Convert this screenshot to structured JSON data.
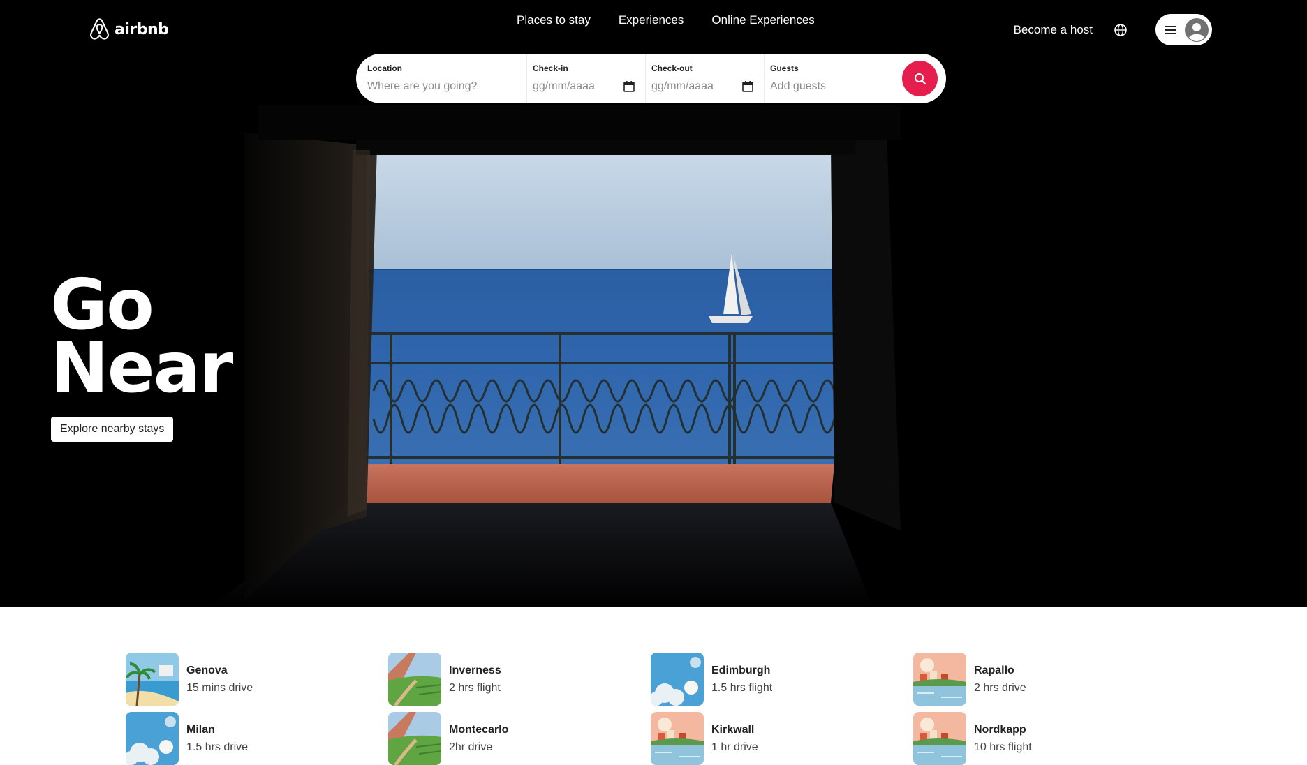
{
  "brand": {
    "logo_text": "airbnb",
    "accent_color": "#e61e4d"
  },
  "nav": {
    "items": [
      {
        "label": "Places to stay"
      },
      {
        "label": "Experiences"
      },
      {
        "label": "Online Experiences"
      }
    ],
    "become_host": "Become a host",
    "globe_icon": "globe-icon",
    "menu_icon": "hamburger-icon",
    "avatar_icon": "user-avatar-icon"
  },
  "search": {
    "location_label": "Location",
    "location_placeholder": "Where are you going?",
    "checkin_label": "Check-in",
    "checkin_placeholder": "gg/mm/aaaa",
    "checkout_label": "Check-out",
    "checkout_placeholder": "gg/mm/aaaa",
    "guests_label": "Guests",
    "guests_placeholder": "Add guests",
    "search_icon": "search-icon"
  },
  "hero": {
    "title_line1": "Go",
    "title_line2": "Near",
    "cta": "Explore nearby stays"
  },
  "nearby": [
    {
      "city": "Genova",
      "distance": "15 mins drive",
      "thumb": "beach-palms"
    },
    {
      "city": "Inverness",
      "distance": "2 hrs flight",
      "thumb": "green-valley"
    },
    {
      "city": "Edimburgh",
      "distance": "1.5 hrs flight",
      "thumb": "blue-sky-clouds"
    },
    {
      "city": "Rapallo",
      "distance": "2 hrs drive",
      "thumb": "lake-village"
    },
    {
      "city": "Milan",
      "distance": "1.5 hrs drive",
      "thumb": "blue-sky-clouds"
    },
    {
      "city": "Montecarlo",
      "distance": "2hr drive",
      "thumb": "green-valley"
    },
    {
      "city": "Kirkwall",
      "distance": "1 hr drive",
      "thumb": "lake-village"
    },
    {
      "city": "Nordkapp",
      "distance": "10 hrs flight",
      "thumb": "lake-village"
    }
  ]
}
